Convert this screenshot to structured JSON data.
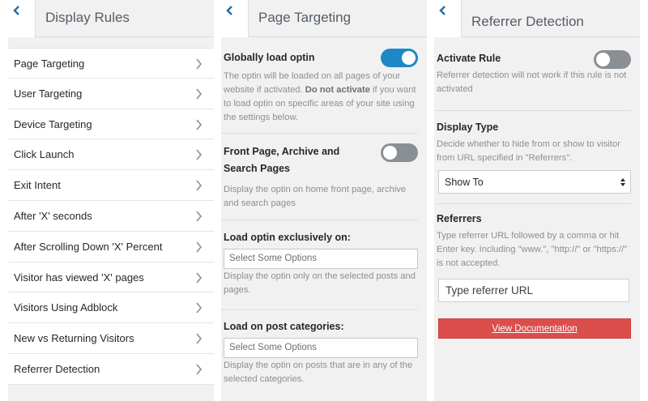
{
  "display_rules": {
    "title": "Display Rules",
    "items": [
      {
        "label": "Page Targeting"
      },
      {
        "label": "User Targeting"
      },
      {
        "label": "Device Targeting"
      },
      {
        "label": "Click Launch"
      },
      {
        "label": "Exit Intent"
      },
      {
        "label": "After 'X' seconds"
      },
      {
        "label": "After Scrolling Down 'X' Percent"
      },
      {
        "label": "Visitor has viewed 'X' pages"
      },
      {
        "label": "Visitors Using Adblock"
      },
      {
        "label": "New vs Returning Visitors"
      },
      {
        "label": "Referrer Detection"
      }
    ]
  },
  "page_targeting": {
    "title": "Page Targeting",
    "global": {
      "label": "Globally load optin",
      "enabled": true,
      "desc_1": "The optin will be loaded on all pages of your website if activated. ",
      "desc_bold": "Do not activate",
      "desc_2": " if you want to load optin on specific areas of your site using the settings below."
    },
    "front_page": {
      "label": "Front Page, Archive and Search Pages",
      "enabled": false,
      "desc": "Display the optin on home front page, archive and search pages"
    },
    "exclusive": {
      "label": "Load optin exclusively on:",
      "placeholder": "Select Some Options",
      "desc": "Display the optin only on the selected posts and pages."
    },
    "categories": {
      "label": "Load on post categories:",
      "placeholder": "Select Some Options",
      "desc": "Display the optin on posts that are in any of the selected categories."
    }
  },
  "referrer_detection": {
    "title": "Referrer Detection",
    "activate": {
      "label": "Activate Rule",
      "enabled": false,
      "desc": "Referrer detection will not work if this rule is not activated"
    },
    "display_type": {
      "label": "Display Type",
      "desc": "Decide whether to hide from or show to visitor from URL specified in \"Referrers\".",
      "selected": "Show To"
    },
    "referrers": {
      "label": "Referrers",
      "desc": "Type referrer URL followed by a comma or hit Enter key. Including \"www.\", \"http://\" or \"https://\" is not accepted.",
      "placeholder": "Type referrer URL"
    },
    "doc_button": "View Documentation"
  },
  "colors": {
    "toggle_on": "#1e88c7",
    "toggle_off": "#8a8f94",
    "doc_button": "#dc4e4c",
    "panel_bg": "#f1f1f1"
  }
}
